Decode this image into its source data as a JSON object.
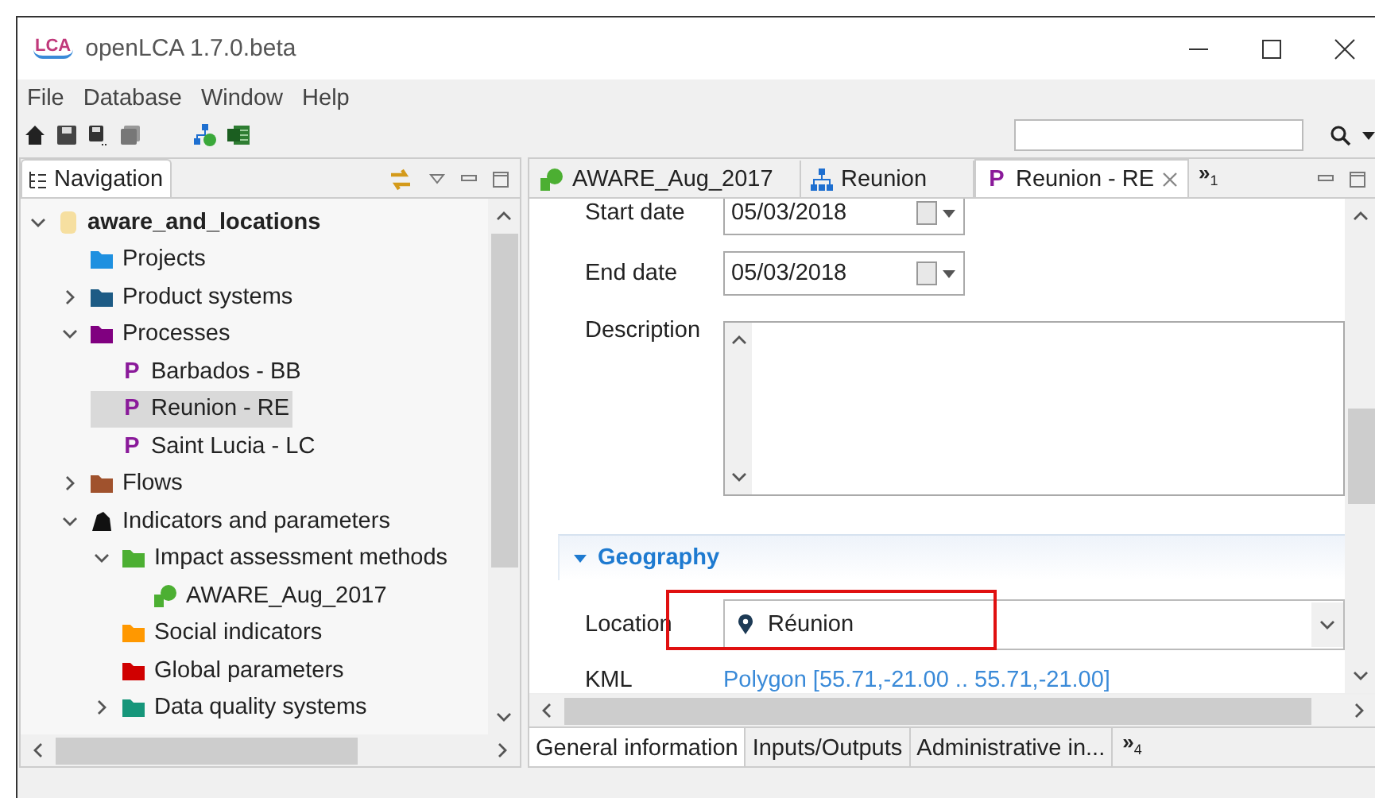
{
  "window": {
    "title": "openLCA 1.7.0.beta",
    "logo": "LCA"
  },
  "menu": [
    "File",
    "Database",
    "Window",
    "Help"
  ],
  "navigation": {
    "tab": "Navigation",
    "tree": [
      {
        "label": "aware_and_locations",
        "kind": "database",
        "bold": true,
        "expanded": true,
        "selected": false,
        "children": [
          {
            "label": "Projects",
            "kind": "folder",
            "color": "#1e90e0",
            "selected": false
          },
          {
            "label": "Product systems",
            "kind": "folder",
            "color": "#1d5b85",
            "expanded": false,
            "selected": false
          },
          {
            "label": "Processes",
            "kind": "folder",
            "color": "#800080",
            "expanded": true,
            "selected": false,
            "children": [
              {
                "label": "Barbados - BB",
                "kind": "process",
                "icon_text": "P",
                "selected": false
              },
              {
                "label": "Reunion - RE",
                "kind": "process",
                "icon_text": "P",
                "selected": true
              },
              {
                "label": "Saint Lucia - LC",
                "kind": "process",
                "icon_text": "P",
                "selected": false
              }
            ]
          },
          {
            "label": "Flows",
            "kind": "folder",
            "color": "#a0522d",
            "expanded": false,
            "selected": false
          },
          {
            "label": "Indicators and parameters",
            "kind": "indicators",
            "expanded": true,
            "selected": false,
            "children": [
              {
                "label": "Impact assessment methods",
                "kind": "folder",
                "color": "#4caf32",
                "expanded": true,
                "selected": false,
                "children": [
                  {
                    "label": "AWARE_Aug_2017",
                    "kind": "method",
                    "selected": false
                  }
                ]
              },
              {
                "label": "Social indicators",
                "kind": "folder",
                "color": "#ff9800",
                "selected": false
              },
              {
                "label": "Global parameters",
                "kind": "folder",
                "color": "#d00000",
                "selected": false
              },
              {
                "label": "Data quality systems",
                "kind": "folder",
                "color": "#16967a",
                "expanded": false,
                "selected": false
              }
            ]
          }
        ]
      }
    ]
  },
  "editor": {
    "tabs": [
      {
        "label": "AWARE_Aug_2017",
        "kind": "method",
        "selected": false
      },
      {
        "label": "Reunion",
        "kind": "graph",
        "selected": false
      },
      {
        "label": "Reunion - RE",
        "kind": "process",
        "icon_text": "P",
        "selected": true,
        "closable": true
      }
    ],
    "tabs_overflow": "»$_{1}$",
    "fields": [
      {
        "label": "Start date",
        "kind": "date",
        "value": "05/03/2018"
      },
      {
        "label": "End date",
        "kind": "date",
        "value": "05/03/2018"
      },
      {
        "label": "Description",
        "kind": "textarea"
      }
    ],
    "section": {
      "title": "Geography",
      "expanded": true,
      "fields": [
        {
          "label": "Location",
          "kind": "combo",
          "value": "Réunion",
          "highlighted": true
        },
        {
          "label": "KML",
          "kind": "link",
          "value": "Polygon [55.71,-21.00 .. 55.71,-21.00]"
        }
      ]
    },
    "bottom_tabs": [
      {
        "label": "General information",
        "selected": true
      },
      {
        "label": "Inputs/Outputs",
        "selected": false
      },
      {
        "label": "Administrative in...",
        "selected": false
      }
    ],
    "bottom_overflow": "»$_{4}$"
  }
}
